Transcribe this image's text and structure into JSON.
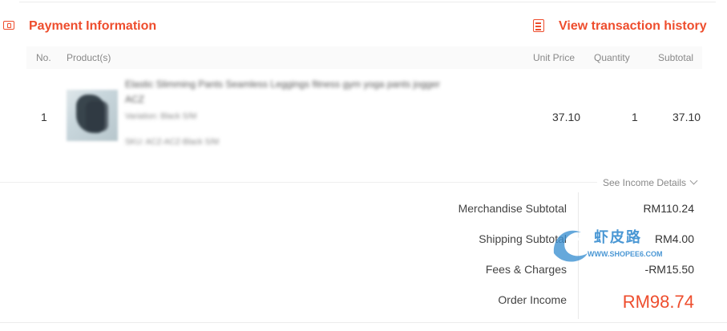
{
  "header": {
    "title": "Payment Information",
    "history_link": "View transaction history",
    "accent_color": "#ee4d2d"
  },
  "table": {
    "columns": [
      "No.",
      "Product(s)",
      "Unit Price",
      "Quantity",
      "Subtotal"
    ],
    "rows": [
      {
        "no": "1",
        "product_name": "Elastic Slimming Pants Seamless Leggings fitness gym yoga pants jogger ACZ",
        "variation": "Variation: Black S/M",
        "sku": "SKU: ACZ-ACZ-Black S/M",
        "unit_price": "37.10",
        "quantity": "1",
        "subtotal": "37.10"
      }
    ]
  },
  "income": {
    "details_toggle": "See Income Details",
    "lines": [
      {
        "label": "Merchandise Subtotal",
        "value": "RM110.24"
      },
      {
        "label": "Shipping Subtotal",
        "value": "RM4.00"
      },
      {
        "label": "Fees & Charges",
        "value": "-RM15.50"
      },
      {
        "label": "Order Income",
        "value": "RM98.74"
      }
    ]
  },
  "watermark": {
    "text": "虾皮路",
    "url": "WWW.SHOPEE6.COM",
    "color": "#3b8fd1"
  }
}
